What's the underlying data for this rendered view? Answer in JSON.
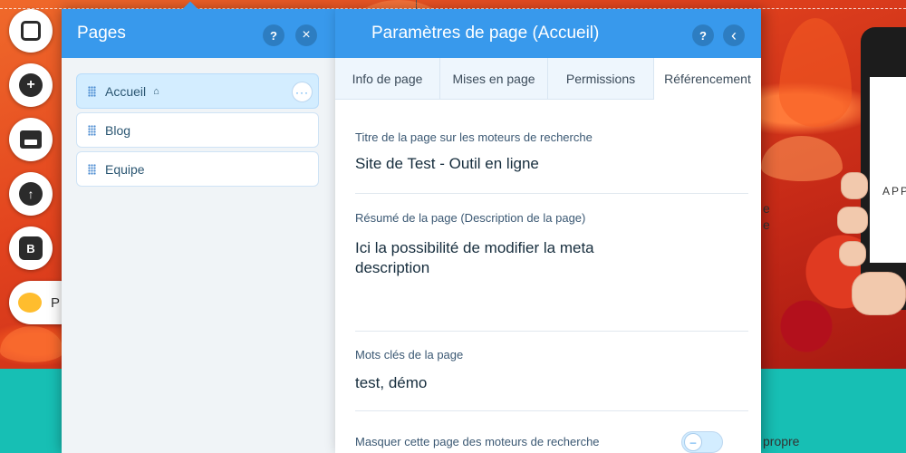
{
  "toolbar": {
    "items": [
      {
        "icon": "square-icon"
      },
      {
        "icon": "plus-icon"
      },
      {
        "icon": "store-icon"
      },
      {
        "icon": "upload-icon"
      },
      {
        "icon": "blog-icon",
        "glyph": "B"
      },
      {
        "icon": "chat-bubble-icon",
        "label": "P"
      }
    ]
  },
  "pages_panel": {
    "title": "Pages",
    "help_glyph": "?",
    "close_glyph": "×",
    "pages": [
      {
        "label": "Accueil",
        "is_home": true,
        "selected": true
      },
      {
        "label": "Blog",
        "is_home": false,
        "selected": false
      },
      {
        "label": "Equipe",
        "is_home": false,
        "selected": false
      }
    ],
    "more_glyph": "···",
    "home_glyph": "⌂"
  },
  "settings_panel": {
    "title": "Paramètres de page (Accueil)",
    "help_glyph": "?",
    "back_glyph": "‹",
    "tabs": [
      {
        "label": "Info de page",
        "active": false
      },
      {
        "label": "Mises en page",
        "active": false
      },
      {
        "label": "Permissions",
        "active": false
      },
      {
        "label": "Référencement",
        "active": true
      }
    ],
    "fields": {
      "seo_title_label": "Titre de la page sur les moteurs de recherche",
      "seo_title_value": "Site de Test - Outil en ligne",
      "description_label": "Résumé de la page (Description de la page)",
      "description_value": "Ici la possibilité de modifier la meta description",
      "keywords_label": "Mots clés de la page",
      "keywords_value": "test, démo",
      "hide_label": "Masquer cette page des moteurs de recherche"
    },
    "toggle_glyph": "–"
  },
  "background": {
    "phone_text": "APP",
    "side_text_1": "e",
    "side_text_2": "e",
    "bottom_text": "propre"
  },
  "colors": {
    "accent": "#3899ec",
    "teal": "#17bfb4",
    "hero_red": "#e2431e"
  }
}
